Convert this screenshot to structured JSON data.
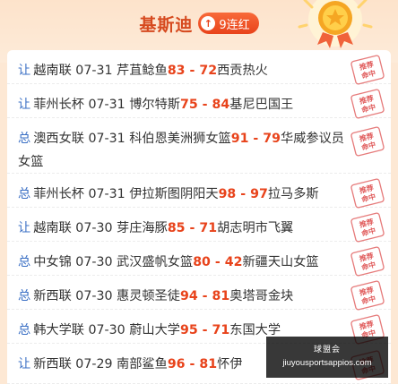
{
  "header": {
    "expert_name": "基斯迪",
    "streak_icon": "up-arrow",
    "streak_label": "9连红"
  },
  "rows": [
    {
      "tag": "让",
      "league": "越南联",
      "date": "07-31",
      "home": "芹苴鲶鱼",
      "score": "83 - 72",
      "away": "西贡热火",
      "stamp": "推荐命中"
    },
    {
      "tag": "让",
      "league": "菲州长杯",
      "date": "07-31",
      "home": "博尔特斯",
      "score": "75 - 84",
      "away": "基尼巴国王",
      "stamp": "推荐命中"
    },
    {
      "tag": "总",
      "league": "澳西女联",
      "date": "07-31",
      "home": "科伯恩美洲狮女篮",
      "score": "91 - 79",
      "away": "华威参议员女篮",
      "stamp": "推荐命中"
    },
    {
      "tag": "总",
      "league": "菲州长杯",
      "date": "07-31",
      "home": "伊拉斯图阴阳天",
      "score": "98 - 97",
      "away": "拉马多斯",
      "stamp": "推荐命中"
    },
    {
      "tag": "让",
      "league": "越南联",
      "date": "07-30",
      "home": "芽庄海豚",
      "score": "85 - 71",
      "away": "胡志明市飞翼",
      "stamp": "推荐命中"
    },
    {
      "tag": "总",
      "league": "中女锦",
      "date": "07-30",
      "home": "武汉盛帆女篮",
      "score": "80 - 42",
      "away": "新疆天山女篮",
      "stamp": "推荐命中"
    },
    {
      "tag": "总",
      "league": "新西联",
      "date": "07-30",
      "home": "惠灵顿圣徒",
      "score": "94 - 81",
      "away": "奥塔哥金块",
      "stamp": "推荐命中"
    },
    {
      "tag": "总",
      "league": "韩大学联",
      "date": "07-30",
      "home": "蔚山大学",
      "score": "95 - 71",
      "away": "东国大学",
      "stamp": "推荐命中"
    },
    {
      "tag": "让",
      "league": "新西联",
      "date": "07-29",
      "home": "南部鲨鱼",
      "score": "96 - 81",
      "away": "怀伊",
      "stamp": "推荐命中"
    }
  ],
  "colors": {
    "tag": "#3a6fc4",
    "score": "#e8431b",
    "stamp": "#e05a5a",
    "name": "#d64a1f"
  },
  "watermark": {
    "line1": "球盟会",
    "line2": "jiuyousportsappios.com"
  }
}
